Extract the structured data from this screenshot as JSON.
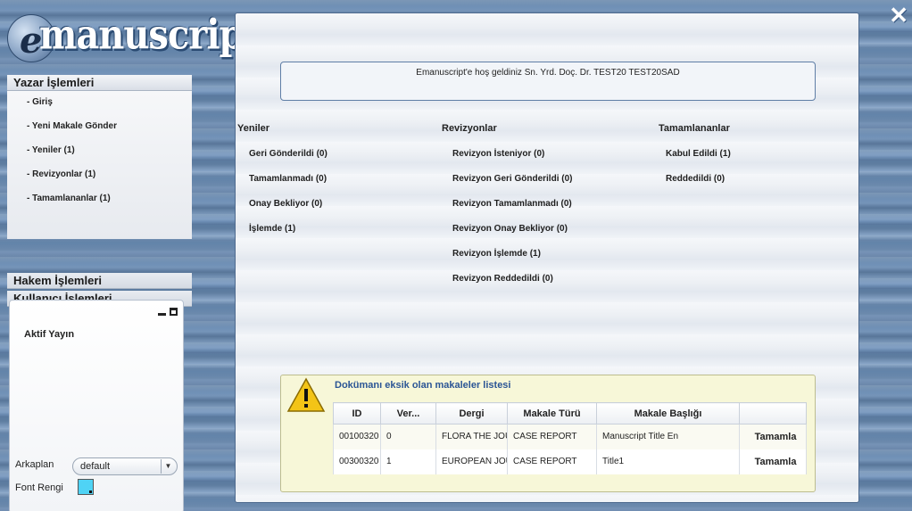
{
  "logo": {
    "prefix": "e",
    "name": "manuscript"
  },
  "sidebar": {
    "author_section": "Yazar İşlemleri",
    "author_items": [
      {
        "label": "- Giriş"
      },
      {
        "label": "- Yeni Makale Gönder"
      },
      {
        "label": "- Yeniler (1)"
      },
      {
        "label": "- Revizyonlar (1)"
      },
      {
        "label": "- Tamamlananlar (1)"
      }
    ],
    "reviewer_section": "Hakem İşlemleri",
    "user_section": "Kullanıcı İşlemleri"
  },
  "widget": {
    "title": "Aktif Yayın",
    "background_label": "Arkaplan",
    "background_value": "default",
    "font_color_label": "Font Rengi",
    "font_color": "#4fd3f5"
  },
  "main": {
    "welcome": "Emanuscript'e hoş geldiniz Sn. Yrd. Doç. Dr. TEST20 TEST20SAD",
    "new_col": {
      "title": "Yeniler",
      "items": [
        "Geri Gönderildi (0)",
        "Tamamlanmadı (0)",
        "Onay Bekliyor (0)",
        "İşlemde (1)"
      ]
    },
    "revision_col": {
      "title": "Revizyonlar",
      "items": [
        "Revizyon İsteniyor (0)",
        "Revizyon Geri Gönderildi (0)",
        "Revizyon Tamamlanmadı (0)",
        "Revizyon Onay Bekliyor (0)",
        "Revizyon İşlemde (1)",
        "Revizyon Reddedildi (0)"
      ]
    },
    "done_col": {
      "title": "Tamamlananlar",
      "items": [
        "Kabul Edildi (1)",
        "Reddedildi (0)"
      ]
    },
    "missing_docs": {
      "title": "Dokümanı eksik olan makaleler listesi",
      "headers": [
        "ID",
        "Ver...",
        "Dergi",
        "Makale Türü",
        "Makale Başlığı",
        ""
      ],
      "rows": [
        {
          "id": "00100320",
          "ver": "0",
          "journal": "FLORA THE JOURNAL",
          "type": "CASE REPORT",
          "title": "Manuscript Title En",
          "action": "Tamamla"
        },
        {
          "id": "00300320",
          "ver": "1",
          "journal": "EUROPEAN JOURNAL",
          "type": "CASE REPORT",
          "title": "Title1",
          "action": "Tamamla"
        }
      ]
    }
  },
  "colors": {
    "accent_link": "#2b5595",
    "warning": "#f3c417",
    "note_bg": "#f7f7d8"
  }
}
